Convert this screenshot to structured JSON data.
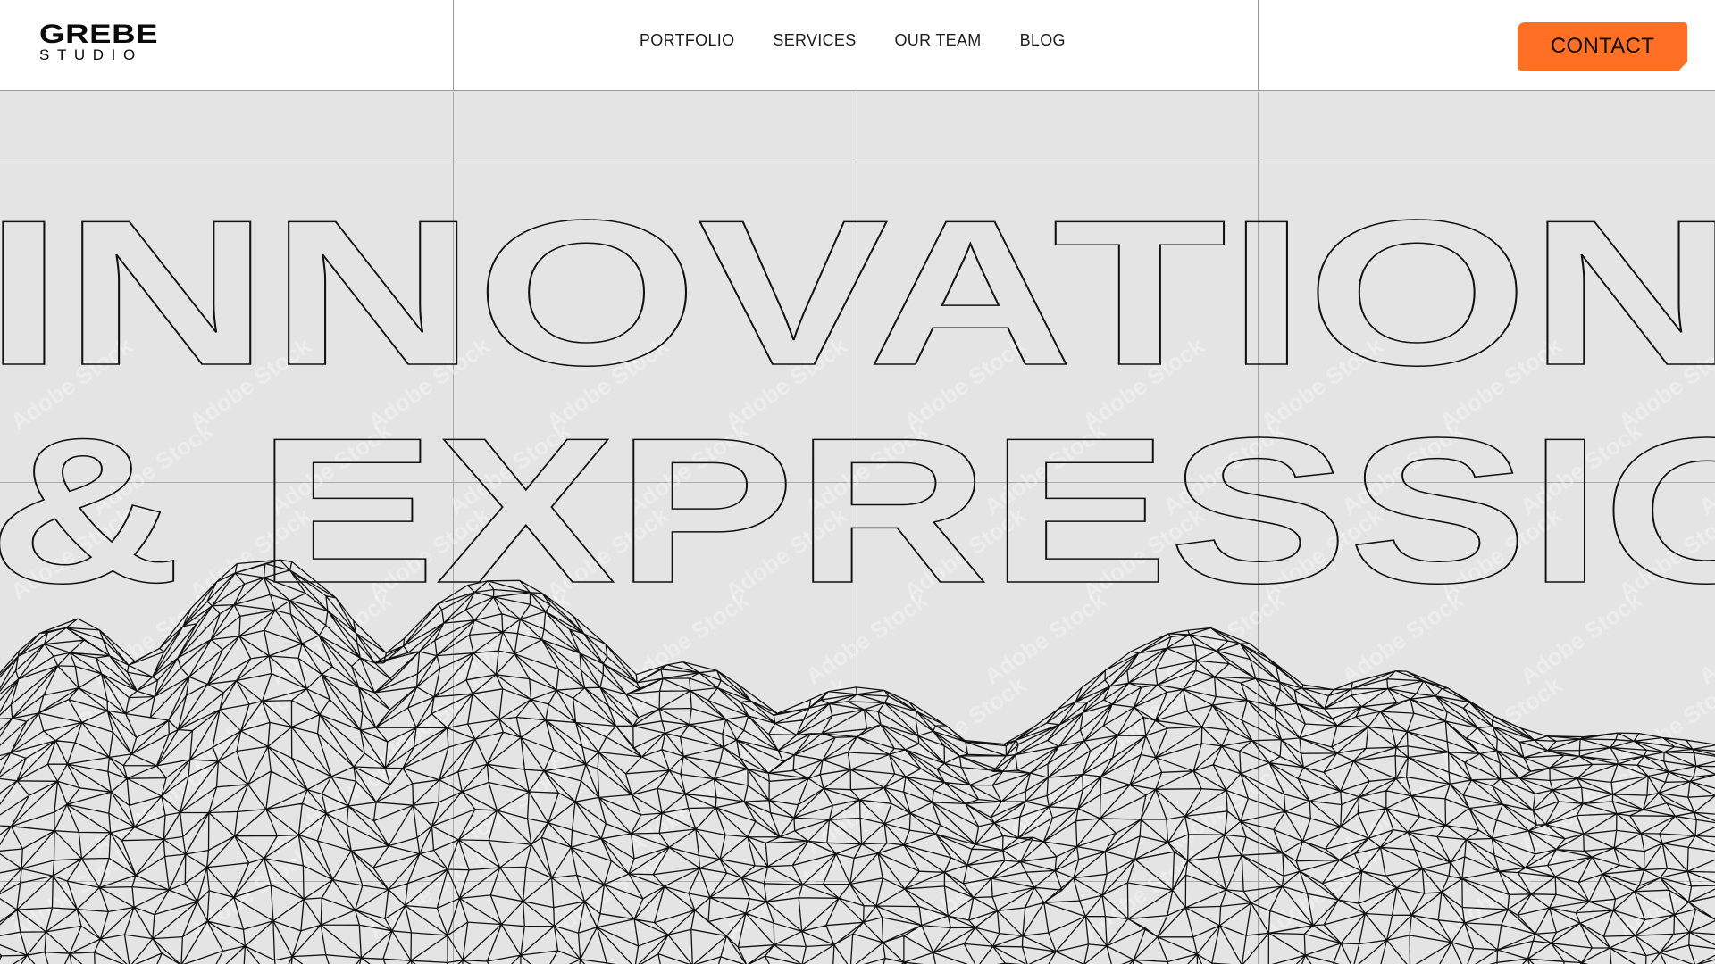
{
  "logo": {
    "top": "GREBE",
    "bottom": "STUDIO"
  },
  "nav": {
    "items": [
      {
        "label": "PORTFOLIO"
      },
      {
        "label": "SERVICES"
      },
      {
        "label": "OUR TEAM"
      },
      {
        "label": "BLOG"
      }
    ]
  },
  "cta": {
    "label": "CONTACT",
    "color": "#ff6f24"
  },
  "hero": {
    "line1": "INNOVATION",
    "line2": "& EXPRESSION",
    "watermark": "Adobe Stock"
  },
  "colors": {
    "header_bg": "#ffffff",
    "hero_bg": "#e4e4e4",
    "outline": "#111111",
    "grid": "#a9a9a9"
  },
  "icons": {
    "terrain": "wireframe-mountain-mesh"
  }
}
